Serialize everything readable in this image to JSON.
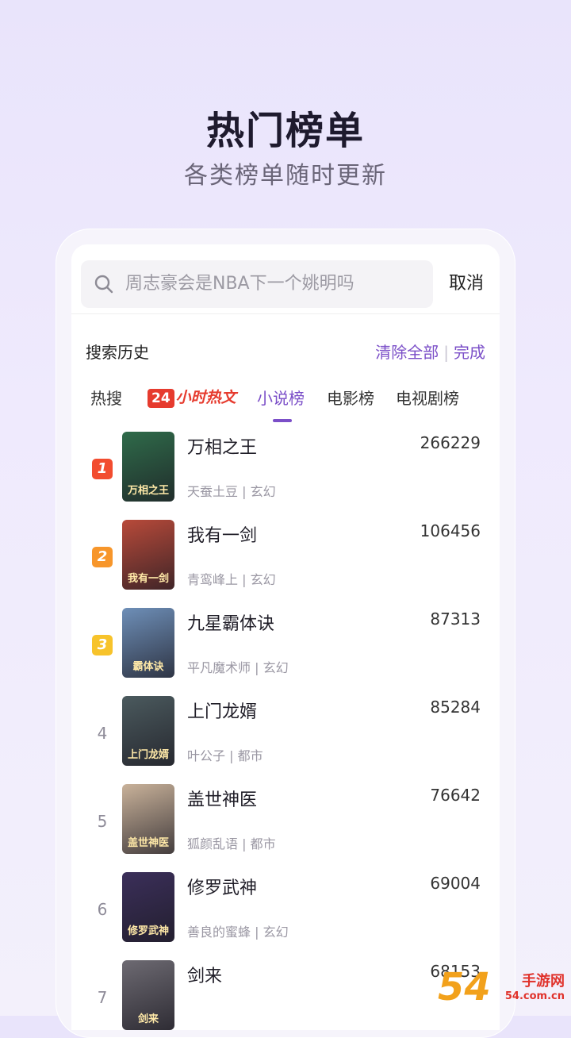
{
  "hero": {
    "title": "热门榜单",
    "subtitle": "各类榜单随时更新"
  },
  "search": {
    "placeholder": "周志豪会是NBA下一个姚明吗",
    "icon": "search-icon",
    "cancel_label": "取消"
  },
  "history": {
    "title": "搜索历史",
    "clear_all_label": "清除全部",
    "separator": "|",
    "done_label": "完成"
  },
  "tabs": [
    {
      "label": "热搜"
    },
    {
      "badge": "24",
      "label": "小时热文"
    },
    {
      "label": "小说榜",
      "active": true
    },
    {
      "label": "电影榜"
    },
    {
      "label": "电视剧榜"
    }
  ],
  "rank_badge_colors": [
    "#f24c2f",
    "#f7962b",
    "#f7c32b"
  ],
  "books": [
    {
      "rank": "1",
      "title": "万相之王",
      "author": "天蚕土豆",
      "genre": "玄幻",
      "meta": "天蚕土豆 | 玄幻",
      "count": "266229",
      "cover_text": "万相之王",
      "cover_color": "#2f6b4a"
    },
    {
      "rank": "2",
      "title": "我有一剑",
      "author": "青鸾峰上",
      "genre": "玄幻",
      "meta": "青鸾峰上 | 玄幻",
      "count": "106456",
      "cover_text": "我有一剑",
      "cover_color": "#b84a3a"
    },
    {
      "rank": "3",
      "title": "九星霸体诀",
      "author": "平凡魔术师",
      "genre": "玄幻",
      "meta": "平凡魔术师 | 玄幻",
      "count": "87313",
      "cover_text": "霸体诀",
      "cover_color": "#6e8fb8"
    },
    {
      "rank": "4",
      "title": "上门龙婿",
      "author": "叶公子",
      "genre": "都市",
      "meta": "叶公子 | 都市",
      "count": "85284",
      "cover_text": "上门龙婿",
      "cover_color": "#4b5a5e"
    },
    {
      "rank": "5",
      "title": "盖世神医",
      "author": "狐颜乱语",
      "genre": "都市",
      "meta": "狐颜乱语 | 都市",
      "count": "76642",
      "cover_text": "盖世神医",
      "cover_color": "#c9b29a"
    },
    {
      "rank": "6",
      "title": "修罗武神",
      "author": "善良的蜜蜂",
      "genre": "玄幻",
      "meta": "善良的蜜蜂 | 玄幻",
      "count": "69004",
      "cover_text": "修罗武神",
      "cover_color": "#3b2f5a"
    },
    {
      "rank": "7",
      "title": "剑来",
      "author": "",
      "genre": "",
      "meta": "",
      "count": "68153",
      "cover_text": "剑来",
      "cover_color": "#6d6a72"
    }
  ],
  "watermark": {
    "big": "54",
    "small": "手游网",
    "url": "54.com.cn"
  }
}
